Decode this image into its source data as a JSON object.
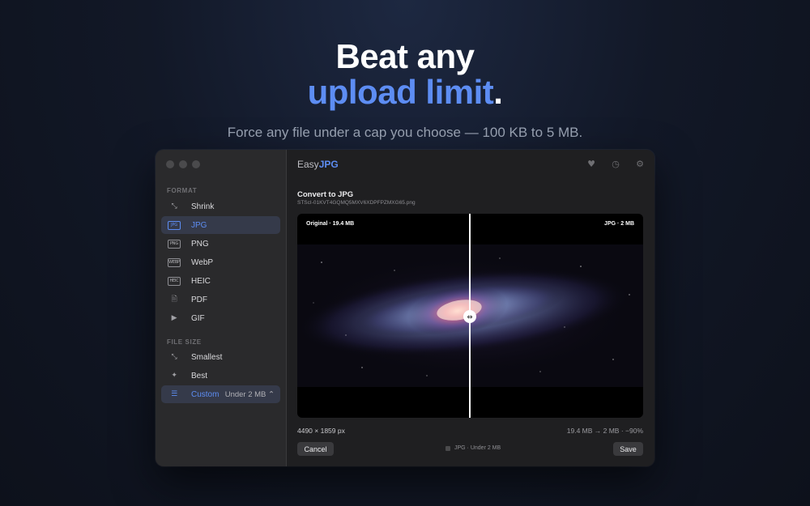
{
  "hero": {
    "line1": "Beat any",
    "line2_accent": "upload limit",
    "line2_end": ".",
    "subtitle": "Force any file under a cap you choose — 100 KB to 5 MB."
  },
  "sidebar": {
    "format_label": "FORMAT",
    "format_items": [
      {
        "label": "Shrink",
        "icon": "⤡",
        "icon_name": "shrink-icon"
      },
      {
        "label": "JPG",
        "icon": "JPG",
        "icon_name": "jpg-icon",
        "active": true
      },
      {
        "label": "PNG",
        "icon": "PNG",
        "icon_name": "png-icon"
      },
      {
        "label": "WebP",
        "icon": "WEBP",
        "icon_name": "webp-icon"
      },
      {
        "label": "HEIC",
        "icon": "HEIC",
        "icon_name": "heic-icon"
      },
      {
        "label": "PDF",
        "icon": "🗎",
        "icon_name": "document-icon"
      },
      {
        "label": "GIF",
        "icon": "▶",
        "icon_name": "play-icon"
      }
    ],
    "size_label": "FILE SIZE",
    "size_items": [
      {
        "label": "Smallest",
        "icon": "⤡",
        "icon_name": "shrink-icon"
      },
      {
        "label": "Best",
        "icon": "✦",
        "icon_name": "sparkle-icon"
      },
      {
        "label": "Custom",
        "icon": "☰",
        "icon_name": "list-icon",
        "active": true,
        "value": "Under 2 MB ⌃"
      }
    ]
  },
  "main": {
    "brand_prefix": "Easy",
    "brand_accent": "JPG",
    "icons": {
      "favorite": "♥",
      "history": "◷",
      "settings": "⚙"
    },
    "convert_title": "Convert to JPG",
    "filename": "STScI-01KVT4GQMQ5MXV6XDPFPZMXG65.png",
    "original_tag": "Original · 19.4 MB",
    "result_tag": "JPG · 2 MB",
    "split_handle": "⇔",
    "dimensions": "4490 × 1859 px",
    "savings": "19.4 MB → 2 MB · −90%",
    "cancel_label": "Cancel",
    "save_label": "Save",
    "status": "JPG · Under 2 MB"
  },
  "colors": {
    "accent": "#5d8df3",
    "background": "#121827"
  }
}
